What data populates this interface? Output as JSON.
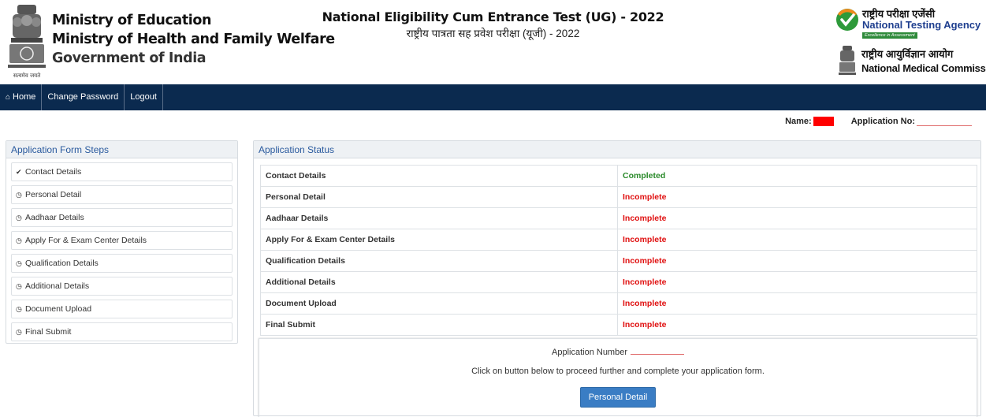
{
  "header": {
    "emblem_caption": "सत्यमेव जयते",
    "ministries": [
      "Ministry of Education",
      "Ministry of Health and Family Welfare",
      "Government of India"
    ],
    "exam_title": "National Eligibility Cum Entrance Test (UG) - 2022",
    "exam_title_hindi": "राष्ट्रीय पात्रता सह प्रवेश परीक्षा (यूजी) - 2022",
    "nta_hindi": "राष्ट्रीय परीक्षा एजेंसी",
    "nta_english": "National Testing Agency",
    "nta_tagline": "Excellence in Assessment",
    "nmc_hindi": "राष्ट्रीय आयुर्विज्ञान आयोग",
    "nmc_english": "National Medical Commission"
  },
  "nav": {
    "home": "Home",
    "change_password": "Change Password",
    "logout": "Logout",
    "home_icon": "home-icon"
  },
  "user": {
    "name_label": "Name:",
    "application_no_label": "Application No:"
  },
  "steps_panel": {
    "title": "Application Form Steps",
    "items": [
      {
        "label": "Contact Details",
        "icon": "check-circle-icon"
      },
      {
        "label": "Personal Detail",
        "icon": "clock-icon"
      },
      {
        "label": "Aadhaar Details",
        "icon": "clock-icon"
      },
      {
        "label": "Apply For & Exam Center Details",
        "icon": "clock-icon"
      },
      {
        "label": "Qualification Details",
        "icon": "clock-icon"
      },
      {
        "label": "Additional Details",
        "icon": "clock-icon"
      },
      {
        "label": "Document Upload",
        "icon": "clock-icon"
      },
      {
        "label": "Final Submit",
        "icon": "clock-icon"
      }
    ]
  },
  "status_panel": {
    "title": "Application Status",
    "rows": [
      {
        "label": "Contact Details",
        "status": "Completed"
      },
      {
        "label": "Personal Detail",
        "status": "Incomplete"
      },
      {
        "label": "Aadhaar Details",
        "status": "Incomplete"
      },
      {
        "label": "Apply For & Exam Center Details",
        "status": "Incomplete"
      },
      {
        "label": "Qualification Details",
        "status": "Incomplete"
      },
      {
        "label": "Additional Details",
        "status": "Incomplete"
      },
      {
        "label": "Document Upload",
        "status": "Incomplete"
      },
      {
        "label": "Final Submit",
        "status": "Incomplete"
      }
    ],
    "completed_color": "#2a8a2a",
    "incomplete_color": "#e01010"
  },
  "info_box": {
    "application_number_label": "Application Number",
    "message": "Click on button below to proceed further and complete your application form.",
    "button_label": "Personal Detail"
  },
  "colors": {
    "nav_bg": "#0b2a4f",
    "panel_title": "#2a5a9e",
    "button": "#3a7dc4",
    "redacted": "#ff0000"
  }
}
